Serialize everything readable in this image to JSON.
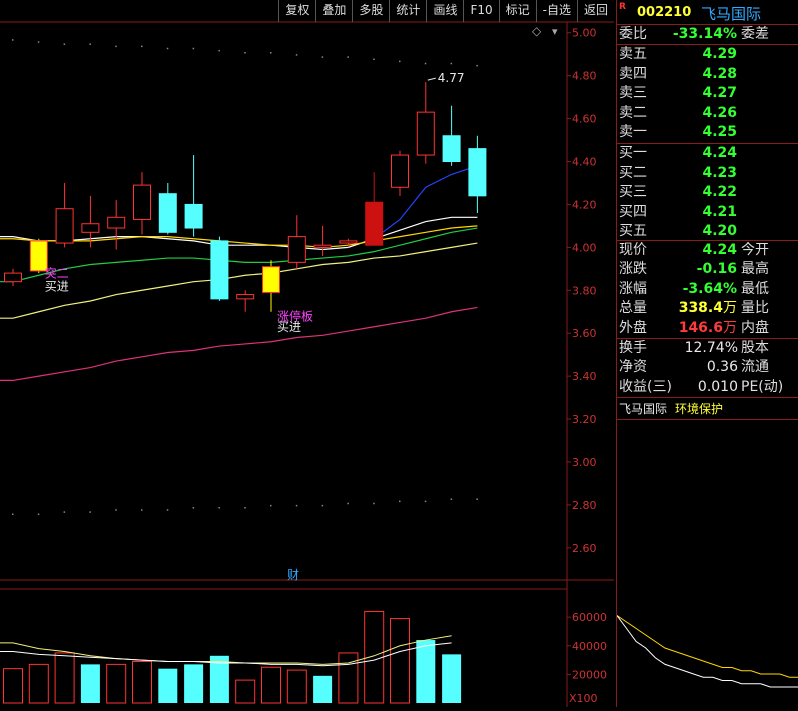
{
  "toolbar": {
    "items": [
      "复权",
      "叠加",
      "多股",
      "统计",
      "画线",
      "F10",
      "标记",
      "-自选",
      "返回"
    ]
  },
  "quote": {
    "r_badge": "R",
    "code": "002210",
    "name": "飞马国际",
    "weibi_label": "委比",
    "weibi": "-33.14%",
    "weicha_label": "委差",
    "asks": [
      {
        "label": "卖五",
        "price": "4.29"
      },
      {
        "label": "卖四",
        "price": "4.28"
      },
      {
        "label": "卖三",
        "price": "4.27"
      },
      {
        "label": "卖二",
        "price": "4.26"
      },
      {
        "label": "卖一",
        "price": "4.25"
      }
    ],
    "bids": [
      {
        "label": "买一",
        "price": "4.24"
      },
      {
        "label": "买二",
        "price": "4.23"
      },
      {
        "label": "买三",
        "price": "4.22"
      },
      {
        "label": "买四",
        "price": "4.21"
      },
      {
        "label": "买五",
        "price": "4.20"
      }
    ],
    "stats": [
      {
        "label": "现价",
        "value": "4.24",
        "label2": "今开",
        "color": "green"
      },
      {
        "label": "涨跌",
        "value": "-0.16",
        "label2": "最高",
        "color": "green"
      },
      {
        "label": "涨幅",
        "value": "-3.64%",
        "label2": "最低",
        "color": "green"
      },
      {
        "label": "总量",
        "value": "338.4",
        "unit": "万",
        "label2": "量比",
        "color": "yellow"
      },
      {
        "label": "外盘",
        "value": "146.6",
        "unit": "万",
        "label2": "内盘",
        "color": "red"
      }
    ],
    "stats2": [
      {
        "label": "换手",
        "value": "12.74%",
        "label2": "股本"
      },
      {
        "label": "净资",
        "value": "0.36",
        "label2": "流通"
      },
      {
        "label": "收益(三)",
        "value": "0.010",
        "label2": "PE(动)"
      }
    ],
    "tags": [
      "飞马国际",
      "环境保护"
    ]
  },
  "chart_data": [
    {
      "type": "candlestick",
      "ylim": [
        2.45,
        5.05
      ],
      "y_ticks": [
        "5.00",
        "4.80",
        "4.60",
        "4.40",
        "4.20",
        "4.00",
        "3.80",
        "3.60",
        "3.40",
        "3.20",
        "3.00",
        "2.80",
        "2.60"
      ],
      "candles": [
        {
          "o": 3.84,
          "h": 3.9,
          "l": 3.82,
          "c": 3.88
        },
        {
          "o": 4.03,
          "h": 4.04,
          "l": 3.88,
          "c": 3.89
        },
        {
          "o": 4.02,
          "h": 4.3,
          "l": 4.0,
          "c": 4.18
        },
        {
          "o": 4.07,
          "h": 4.24,
          "l": 4.0,
          "c": 4.11
        },
        {
          "o": 4.09,
          "h": 4.22,
          "l": 3.99,
          "c": 4.14
        },
        {
          "o": 4.13,
          "h": 4.35,
          "l": 4.06,
          "c": 4.29
        },
        {
          "o": 4.25,
          "h": 4.3,
          "l": 4.06,
          "c": 4.07
        },
        {
          "o": 4.2,
          "h": 4.43,
          "l": 4.05,
          "c": 4.09
        },
        {
          "o": 4.03,
          "h": 4.05,
          "l": 3.75,
          "c": 3.76
        },
        {
          "o": 3.76,
          "h": 3.8,
          "l": 3.7,
          "c": 3.78
        },
        {
          "o": 3.91,
          "h": 3.94,
          "l": 3.7,
          "c": 3.79
        },
        {
          "o": 3.93,
          "h": 4.15,
          "l": 3.9,
          "c": 4.05
        },
        {
          "o": 4.0,
          "h": 4.1,
          "l": 3.96,
          "c": 4.01
        },
        {
          "o": 4.02,
          "h": 4.04,
          "l": 4.0,
          "c": 4.03
        },
        {
          "o": 4.21,
          "h": 4.35,
          "l": 4.01,
          "c": 4.01
        },
        {
          "o": 4.28,
          "h": 4.45,
          "l": 4.24,
          "c": 4.43
        },
        {
          "o": 4.43,
          "h": 4.77,
          "l": 4.39,
          "c": 4.63
        },
        {
          "o": 4.52,
          "h": 4.66,
          "l": 4.38,
          "c": 4.4
        },
        {
          "o": 4.46,
          "h": 4.52,
          "l": 4.16,
          "c": 4.24
        }
      ],
      "ma_lines": [
        {
          "color": "#2244ff",
          "values": [
            null,
            null,
            null,
            null,
            null,
            null,
            null,
            null,
            null,
            null,
            null,
            null,
            null,
            null,
            4.04,
            4.13,
            4.28,
            4.34,
            4.38
          ]
        },
        {
          "color": "#ffffff",
          "values": [
            4.05,
            4.03,
            4.03,
            4.04,
            4.05,
            4.05,
            4.04,
            4.03,
            4.01,
            4.01,
            4.01,
            4.0,
            3.99,
            4.0,
            4.04,
            4.08,
            4.12,
            4.14,
            4.14
          ]
        },
        {
          "color": "#ffd700",
          "values": [
            4.04,
            4.03,
            4.03,
            4.03,
            4.04,
            4.05,
            4.05,
            4.04,
            4.03,
            4.02,
            4.01,
            4.01,
            4.0,
            4.01,
            4.03,
            4.05,
            4.07,
            4.09,
            4.1
          ]
        },
        {
          "color": "#22cc44",
          "values": [
            3.84,
            3.87,
            3.9,
            3.92,
            3.93,
            3.94,
            3.95,
            3.95,
            3.94,
            3.93,
            3.93,
            3.94,
            3.95,
            3.96,
            3.98,
            4.01,
            4.04,
            4.07,
            4.09
          ]
        },
        {
          "color": "#f0f080",
          "values": [
            3.67,
            3.7,
            3.73,
            3.75,
            3.78,
            3.8,
            3.82,
            3.84,
            3.85,
            3.87,
            3.88,
            3.9,
            3.92,
            3.93,
            3.95,
            3.96,
            3.98,
            4.0,
            4.02
          ]
        },
        {
          "color": "#dd3377",
          "values": [
            3.38,
            3.4,
            3.42,
            3.44,
            3.47,
            3.49,
            3.51,
            3.52,
            3.54,
            3.55,
            3.56,
            3.58,
            3.59,
            3.61,
            3.63,
            3.65,
            3.67,
            3.7,
            3.72
          ]
        }
      ],
      "annotations": [
        {
          "text": "4.77",
          "x_index": 16,
          "y": 4.77,
          "color": "#e8e8e8"
        },
        {
          "text": "突二",
          "x_index": 1,
          "y": 3.86,
          "color": "#ff44ff"
        },
        {
          "text": "买进",
          "x_index": 1,
          "y": 3.8,
          "color": "#e8e8e8"
        },
        {
          "text": "涨停板",
          "x_index": 10,
          "y": 3.66,
          "color": "#ff44ff"
        },
        {
          "text": "买进",
          "x_index": 10,
          "y": 3.61,
          "color": "#e8e8e8"
        }
      ],
      "cai_label": "财",
      "dotted_top": [
        4.97,
        4.96,
        4.95,
        4.95,
        4.94,
        4.94,
        4.93,
        4.93,
        4.92,
        4.91,
        4.91,
        4.9,
        4.89,
        4.89,
        4.88,
        4.87,
        4.86,
        4.86,
        4.85
      ],
      "dotted_bottom": [
        2.76,
        2.76,
        2.77,
        2.77,
        2.78,
        2.78,
        2.78,
        2.79,
        2.79,
        2.79,
        2.8,
        2.8,
        2.8,
        2.81,
        2.81,
        2.82,
        2.82,
        2.83,
        2.83
      ]
    },
    {
      "type": "bar",
      "title": "volume",
      "ylim": [
        0,
        72000
      ],
      "y_ticks": [
        "60000",
        "40000",
        "20000"
      ],
      "unit_label": "X100",
      "values": [
        24000,
        27000,
        35000,
        27000,
        27000,
        29000,
        24000,
        27000,
        33000,
        16000,
        25000,
        23000,
        19000,
        35000,
        64000,
        59000,
        44000,
        34000,
        null
      ],
      "colors": [
        "red",
        "red",
        "red",
        "cyan",
        "red",
        "red",
        "cyan",
        "cyan",
        "cyan",
        "red",
        "red",
        "red",
        "cyan",
        "red",
        "red",
        "red",
        "cyan",
        "cyan",
        null
      ],
      "ma": [
        {
          "color": "#f0f080",
          "values": [
            42000,
            38000,
            36000,
            33000,
            31000,
            30000,
            29000,
            29000,
            29000,
            28000,
            28000,
            28000,
            27000,
            28000,
            33000,
            40000,
            44000,
            47000,
            null
          ]
        },
        {
          "color": "#ffffff",
          "values": [
            36000,
            34000,
            33000,
            32000,
            31000,
            30000,
            29000,
            29000,
            28000,
            28000,
            27000,
            27000,
            26000,
            27000,
            30000,
            36000,
            40000,
            42000,
            null
          ]
        }
      ]
    },
    {
      "type": "line",
      "title": "intraday",
      "values": [
        4.46,
        4.42,
        4.38,
        4.36,
        4.33,
        4.31,
        4.3,
        4.29,
        4.28,
        4.27,
        4.27,
        4.26,
        4.26,
        4.25,
        4.25,
        4.25,
        4.24,
        4.24,
        4.24,
        4.24
      ],
      "avg": [
        4.46,
        4.44,
        4.42,
        4.4,
        4.38,
        4.36,
        4.35,
        4.34,
        4.33,
        4.32,
        4.31,
        4.3,
        4.3,
        4.29,
        4.29,
        4.28,
        4.28,
        4.28,
        4.27,
        4.27
      ]
    }
  ]
}
